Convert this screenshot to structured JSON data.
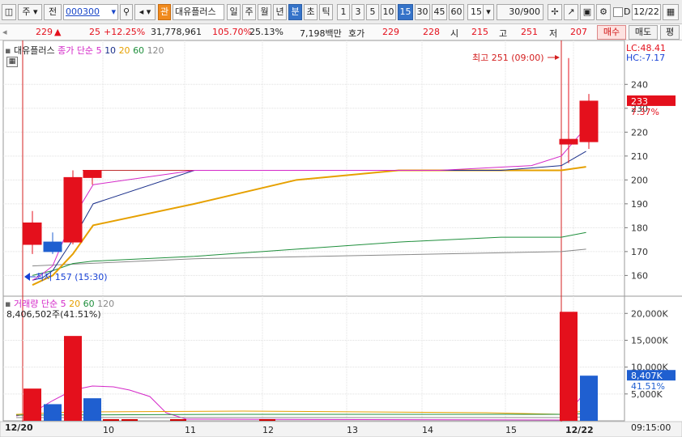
{
  "toolbar": {
    "market": "주",
    "period_type": "전",
    "code": "000300",
    "name": "대유플러스",
    "period_buttons": [
      "일",
      "주",
      "월",
      "년",
      "분",
      "초",
      "틱"
    ],
    "period_selected": "분",
    "minute_buttons": [
      "1",
      "3",
      "5",
      "10",
      "15",
      "30",
      "45",
      "60"
    ],
    "minute_selected": "15",
    "minute_value": "15",
    "count": "30",
    "count_max": "/900",
    "d_label": "D",
    "date": "12/22"
  },
  "quote": {
    "price": "229",
    "arrow": "▲",
    "change": "25",
    "change_pct": "+12.25%",
    "volume": "31,778,961",
    "volume_ratio": "105.70%",
    "turnover": "25.13%",
    "amount": "7,198백만",
    "ask_label": "호가",
    "ask": "229",
    "bid": "228",
    "open_label": "시",
    "open": "215",
    "high_label": "고",
    "high": "251",
    "low_label": "저",
    "low": "207",
    "buy_button": "매수",
    "sell_button": "매도",
    "eval_button": "평"
  },
  "price_panel": {
    "stock_label": "대유플러스",
    "indicator_label": "종가 단순",
    "ma_periods": [
      "5",
      "10",
      "20",
      "60",
      "120"
    ],
    "lc_label": "LC:48.41",
    "hc_label": "HC:-7.17",
    "max_annotation": "최고 251 (09:00)",
    "min_annotation": "최저 157 (15:30)",
    "current_price_tag": "233",
    "current_pct_tag": "7.37%"
  },
  "volume_panel": {
    "indicator_label": "거래량 단순",
    "ma_periods": [
      "5",
      "20",
      "60",
      "120"
    ],
    "volume_summary": "8,406,502주(41.51%)",
    "current_tag": "8,407K",
    "current_pct_tag": "41.51%"
  },
  "footer": {
    "start_label": "12/20",
    "end_time": "09:15:00"
  },
  "colors": {
    "up": "#e4101c",
    "down": "#1f5fd0",
    "ma5": "#d428c8",
    "ma10": "#1a2f8a",
    "ma20": "#e6a000",
    "ma60": "#1f8f3c",
    "ma120": "#888888"
  },
  "chart_data": [
    {
      "type": "candlestick",
      "title": "대유플러스",
      "x": [
        "12/20 a",
        "12/20 b",
        "12/20 c",
        "12/20 d",
        "12/22 a",
        "12/22 b"
      ],
      "open": [
        173,
        174,
        174,
        201,
        215,
        216
      ],
      "high": [
        187,
        178,
        204,
        204,
        251,
        236
      ],
      "low": [
        169,
        169,
        173,
        198,
        207,
        213
      ],
      "close": [
        182,
        170,
        201,
        204,
        217,
        233
      ],
      "moving_averages": {
        "ma5": {
          "x": [
            0,
            0.4,
            1,
            2,
            3,
            4,
            5,
            5.5,
            6.4,
            7.3,
            7.5,
            8.4
          ],
          "y": [
            158,
            160,
            164,
            184,
            198,
            204,
            204,
            204,
            204,
            206,
            210,
            222
          ]
        },
        "ma10": {
          "x": [
            0,
            0.5,
            1,
            2,
            3,
            4,
            5,
            6,
            7,
            7.5,
            8.4
          ],
          "y": [
            158,
            159,
            162,
            175,
            190,
            204,
            204,
            204,
            204,
            206,
            212
          ]
        },
        "ma20": {
          "x": [
            0,
            1,
            2,
            3,
            4,
            5,
            6,
            7,
            7.5,
            8.4
          ],
          "y": [
            156,
            160,
            169,
            181,
            190,
            200,
            204,
            204,
            204,
            205.5
          ]
        },
        "ma60": {
          "x": [
            0,
            1,
            2,
            3,
            4,
            5,
            6,
            7,
            7.5,
            8.4
          ],
          "y": [
            160,
            162,
            165,
            166,
            168,
            171,
            174,
            176,
            176,
            178
          ]
        },
        "ma120": {
          "x": [
            0,
            4,
            7.5,
            8.4
          ],
          "y": [
            164,
            167,
            170,
            171
          ]
        }
      },
      "ylim": [
        152,
        255
      ],
      "y_ticks": [
        160,
        170,
        180,
        190,
        200,
        210,
        220,
        230,
        240
      ],
      "x_tick_labels": [
        "10",
        "11",
        "12",
        "13",
        "14",
        "15",
        "12/22"
      ],
      "guide_line": 204
    },
    {
      "type": "bar",
      "title": "거래량 단순",
      "x": [
        "12/20 a",
        "12/20 b",
        "12/20 c",
        "12/20 d",
        "12/22 a",
        "12/22 b"
      ],
      "values": [
        6000,
        3100,
        15800,
        4200,
        20300,
        8407
      ],
      "ylim": [
        0,
        22000
      ],
      "y_ticks": [
        "5,000K",
        "10,000K",
        "15,000K",
        "20,000K"
      ],
      "units": "K"
    }
  ]
}
